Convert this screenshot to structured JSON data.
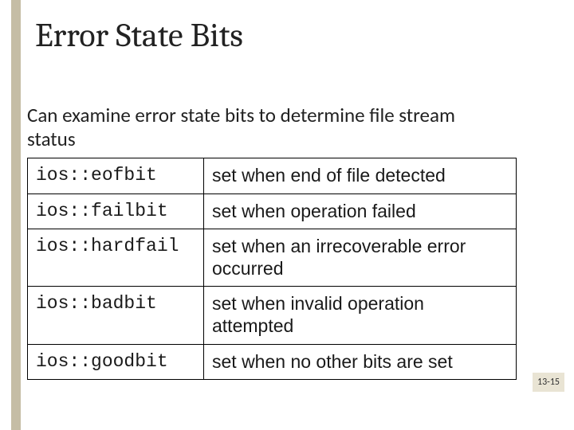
{
  "title": "Error State Bits",
  "subtitle": "Can examine error state bits to determine file stream status",
  "rows": [
    {
      "code": "ios::eofbit",
      "desc": "set when end of file detected"
    },
    {
      "code": "ios::failbit",
      "desc": "set when operation failed"
    },
    {
      "code": "ios::hardfail",
      "desc": "set when an irrecoverable error occurred"
    },
    {
      "code": "ios::badbit",
      "desc": "set when invalid operation attempted"
    },
    {
      "code": "ios::goodbit",
      "desc": "set when no other bits are set"
    }
  ],
  "page_number": "13-15"
}
